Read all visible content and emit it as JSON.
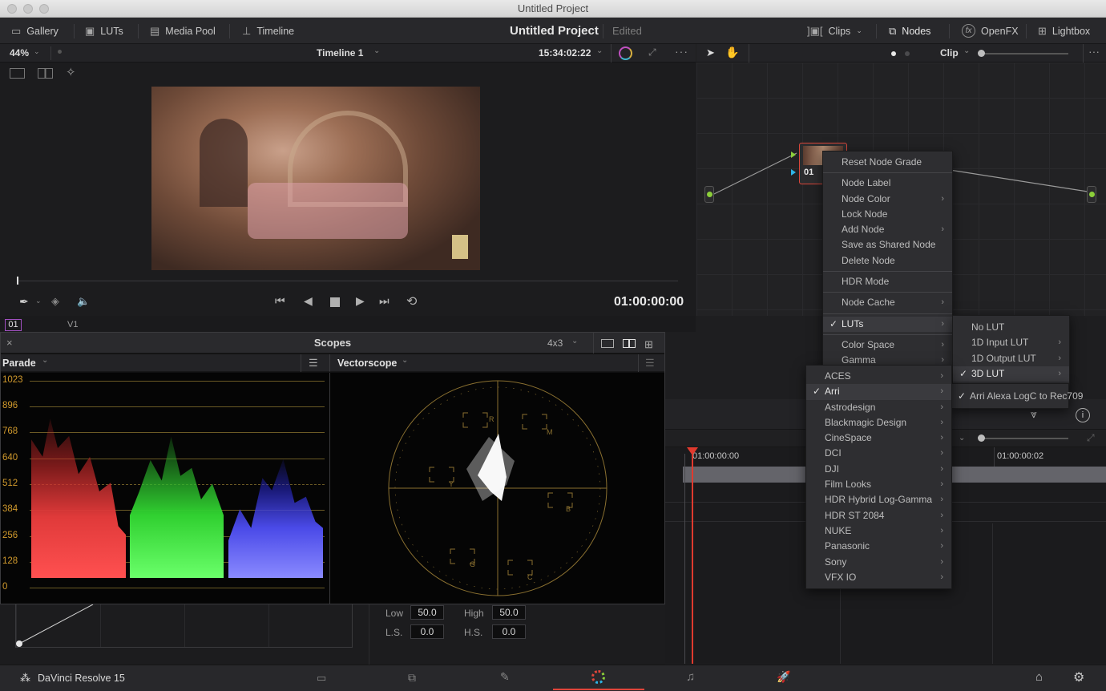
{
  "window": {
    "title": "Untitled Project"
  },
  "topbar": {
    "gallery": "Gallery",
    "luts": "LUTs",
    "media_pool": "Media Pool",
    "timeline": "Timeline",
    "project_title": "Untitled Project",
    "project_status": "Edited",
    "clips": "Clips",
    "nodes": "Nodes",
    "openfx": "OpenFX",
    "lightbox": "Lightbox"
  },
  "viewer": {
    "zoom": "44%",
    "timeline_name": "Timeline 1",
    "timecode_top": "15:34:02:22",
    "timecode": "01:00:00:00",
    "clip_number": "01",
    "track": "V1"
  },
  "node_editor": {
    "mode": "Clip",
    "node_label": "01"
  },
  "context_menu": {
    "items": [
      {
        "label": "Reset Node Grade",
        "sub": false
      },
      {
        "sep": true
      },
      {
        "label": "Node Label",
        "sub": false
      },
      {
        "label": "Node Color",
        "sub": true
      },
      {
        "label": "Lock Node",
        "sub": false
      },
      {
        "label": "Add Node",
        "sub": true
      },
      {
        "label": "Save as Shared Node",
        "sub": false
      },
      {
        "label": "Delete Node",
        "sub": false
      },
      {
        "sep": true
      },
      {
        "label": "HDR Mode",
        "sub": false
      },
      {
        "sep": true
      },
      {
        "label": "Node Cache",
        "sub": true
      },
      {
        "sep": true
      },
      {
        "label": "LUTs",
        "sub": true,
        "checked": true,
        "hl": true
      },
      {
        "sep": true
      },
      {
        "label": "Color Space",
        "sub": true
      },
      {
        "label": "Gamma",
        "sub": true
      }
    ]
  },
  "luts_submenu": {
    "items": [
      {
        "label": "No LUT",
        "sub": false
      },
      {
        "label": "1D Input LUT",
        "sub": true
      },
      {
        "label": "1D Output LUT",
        "sub": true
      },
      {
        "label": "3D LUT",
        "sub": true,
        "checked": true,
        "hl": true
      }
    ]
  },
  "lut3d_submenu": {
    "items": [
      {
        "label": "Arri Alexa LogC to Rec709",
        "checked": true
      }
    ]
  },
  "vendor_submenu": {
    "items": [
      {
        "label": "ACES"
      },
      {
        "label": "Arri",
        "checked": true,
        "hl": true
      },
      {
        "label": "Astrodesign"
      },
      {
        "label": "Blackmagic Design"
      },
      {
        "label": "CineSpace"
      },
      {
        "label": "DCI"
      },
      {
        "label": "DJI"
      },
      {
        "label": "Film Looks"
      },
      {
        "label": "HDR Hybrid Log-Gamma"
      },
      {
        "label": "HDR ST 2084"
      },
      {
        "label": "NUKE"
      },
      {
        "label": "Panasonic"
      },
      {
        "label": "Sony"
      },
      {
        "label": "VFX IO"
      }
    ]
  },
  "scopes": {
    "title": "Scopes",
    "layout": "4x3",
    "left_scope": "Parade",
    "right_scope": "Vectorscope",
    "y_labels": [
      "1023",
      "896",
      "768",
      "640",
      "512",
      "384",
      "256",
      "128",
      "0"
    ],
    "vector_labels": [
      "R",
      "M",
      "B",
      "C",
      "G",
      "Y"
    ]
  },
  "timeline": {
    "tc_start": "01:00:00:00",
    "tc_next": "01:00:00:02"
  },
  "curves": {
    "low_label": "Low",
    "low_value": "50.0",
    "high_label": "High",
    "high_value": "50.0",
    "ls_label": "L.S.",
    "ls_value": "0.0",
    "hs_label": "H.S.",
    "hs_value": "0.0"
  },
  "bottom": {
    "app_name": "DaVinci Resolve 15"
  }
}
